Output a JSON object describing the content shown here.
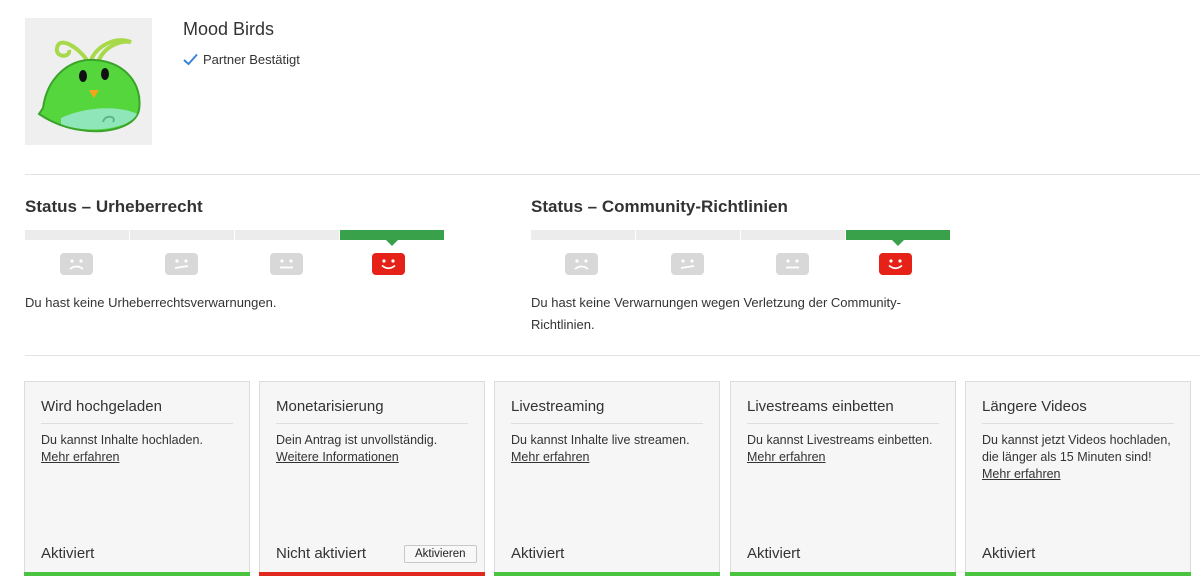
{
  "channel": {
    "name": "Mood Birds",
    "partner_label": "Partner Bestätigt"
  },
  "status_copyright": {
    "title": "Status – Urheberrecht",
    "text": "Du hast keine Urheberrechtsverwarnungen.",
    "active_level": 4,
    "levels": 4
  },
  "status_community": {
    "title": "Status – Community-Richtlinien",
    "text": "Du hast keine Verwarnungen wegen Verletzung der Community-Richtlinien.",
    "active_level": 4,
    "levels": 4
  },
  "colors": {
    "active_green": "#3aa14b",
    "happy_red": "#e62117",
    "enabled_bar": "#4ac43f",
    "disabled_bar": "#e0281e"
  },
  "cards": [
    {
      "title": "Wird hochgeladen",
      "desc": "Du kannst Inhalte hochladen.",
      "link": "Mehr erfahren",
      "state": "Aktiviert"
    },
    {
      "title": "Monetarisierung",
      "desc": "Dein Antrag ist unvollständig.",
      "link": "Weitere Informationen",
      "state": "Nicht aktiviert",
      "button": "Aktivieren"
    },
    {
      "title": "Livestreaming",
      "desc": "Du kannst Inhalte live streamen.",
      "link": "Mehr erfahren",
      "state": "Aktiviert"
    },
    {
      "title": "Livestreams einbetten",
      "desc": "Du kannst Livestreams einbetten.",
      "link": "Mehr erfahren",
      "state": "Aktiviert"
    },
    {
      "title": "Längere Videos",
      "desc": "Du kannst jetzt Videos hochladen, die länger als 15 Minuten sind!",
      "link": "Mehr erfahren",
      "state": "Aktiviert"
    }
  ]
}
